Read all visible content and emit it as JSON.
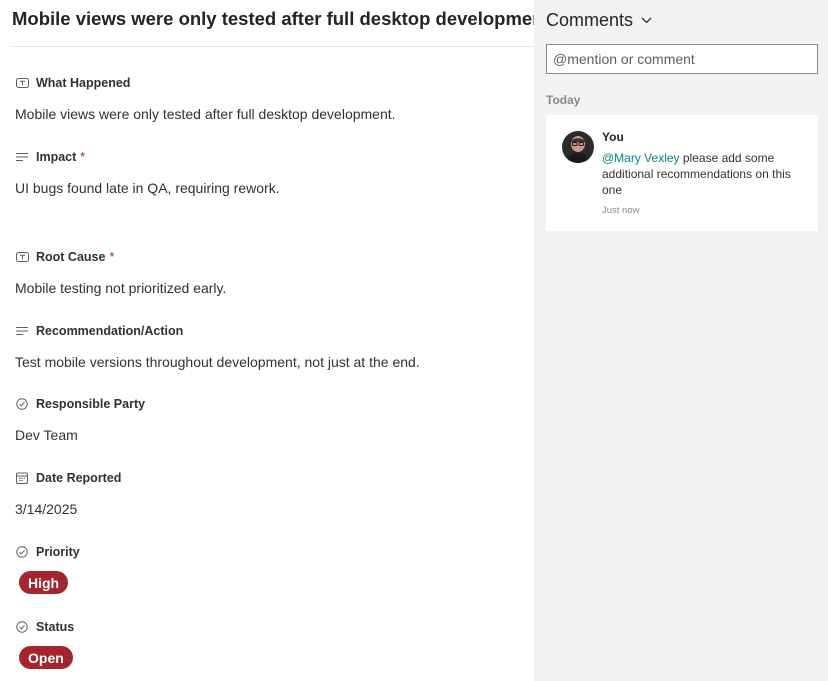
{
  "item": {
    "title": "Mobile views were only tested after full desktop development."
  },
  "fields": [
    {
      "label": "What Happened",
      "icon": "text-field-icon",
      "required": false,
      "value": "Mobile views were only tested after full desktop development."
    },
    {
      "label": "Impact",
      "icon": "multiline-text-icon",
      "required": true,
      "value": "UI bugs found late in QA, requiring rework."
    },
    {
      "label": "Root Cause",
      "icon": "text-field-icon",
      "required": true,
      "value": "Mobile testing not prioritized early."
    },
    {
      "label": "Recommendation/Action",
      "icon": "multiline-text-icon",
      "required": false,
      "value": "Test mobile versions throughout development, not just at the end."
    },
    {
      "label": "Responsible Party",
      "icon": "choice-check-icon",
      "required": false,
      "value": "Dev Team"
    },
    {
      "label": "Date Reported",
      "icon": "calendar-icon",
      "required": false,
      "value": "3/14/2025"
    },
    {
      "label": "Priority",
      "icon": "choice-check-icon",
      "required": false,
      "value": "High",
      "badge_color": "#a4262c"
    },
    {
      "label": "Status",
      "icon": "choice-check-icon",
      "required": false,
      "value": "Open",
      "badge_color": "#a4262c"
    }
  ],
  "required_marker": "*",
  "comments": {
    "header": "Comments",
    "input_placeholder": "@mention or comment",
    "group_label": "Today",
    "items": [
      {
        "author": "You",
        "mention": "@Mary Vexley",
        "text": " please add some additional recommendations on this one",
        "time": "Just now"
      }
    ]
  },
  "colors": {
    "accent_mention": "#038387",
    "badge_red": "#a4262c",
    "side_panel_bg": "#f3f2f1"
  }
}
